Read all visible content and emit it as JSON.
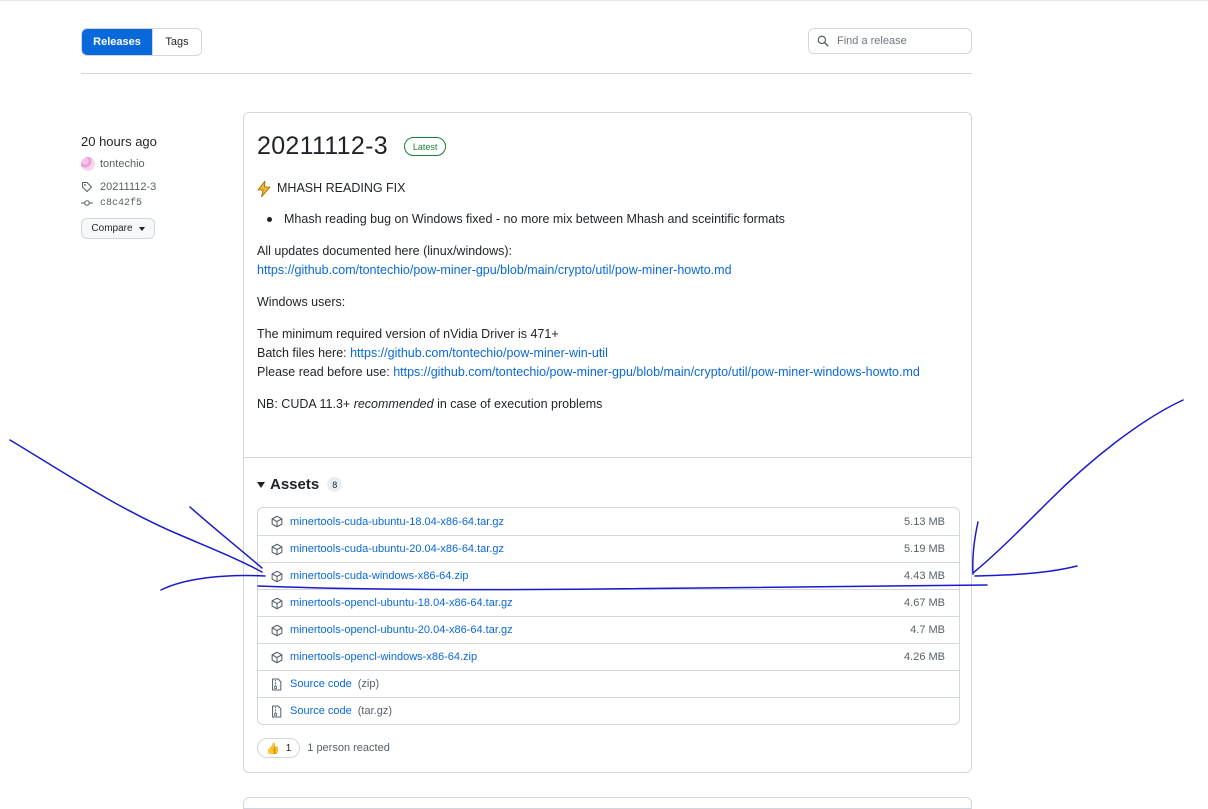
{
  "tabs": {
    "releases_label": "Releases",
    "tags_label": "Tags"
  },
  "search": {
    "placeholder": "Find a release"
  },
  "meta": {
    "time": "20 hours ago",
    "author": "tontechio",
    "tag": "20211112-3",
    "commit": "c8c42f5",
    "compare_label": "Compare"
  },
  "release": {
    "title": "20211112-3",
    "badge": "Latest",
    "fix_heading": "MHASH READING FIX",
    "bullet": "Mhash reading bug on Windows fixed - no more mix between Mhash and sceintific formats",
    "updates_text": "All updates documented here (linux/windows):",
    "updates_link": "https://github.com/tontechio/pow-miner-gpu/blob/main/crypto/util/pow-miner-howto.md",
    "windows_users": "Windows users:",
    "min_driver": "The minimum required version of nVidia Driver is 471+",
    "batch_prefix": "Batch files here: ",
    "batch_link": "https://github.com/tontechio/pow-miner-win-util",
    "read_prefix": "Please read before use: ",
    "read_link": "https://github.com/tontechio/pow-miner-gpu/blob/main/crypto/util/pow-miner-windows-howto.md",
    "nb_prefix": "NB: CUDA 11.3+ ",
    "nb_em": "recommended",
    "nb_suffix": " in case of execution problems"
  },
  "assets": {
    "title": "Assets",
    "count": "8",
    "files": [
      {
        "name": "minertools-cuda-ubuntu-18.04-x86-64.tar.gz",
        "size": "5.13 MB"
      },
      {
        "name": "minertools-cuda-ubuntu-20.04-x86-64.tar.gz",
        "size": "5.19 MB"
      },
      {
        "name": "minertools-cuda-windows-x86-64.zip",
        "size": "4.43 MB"
      },
      {
        "name": "minertools-opencl-ubuntu-18.04-x86-64.tar.gz",
        "size": "4.67 MB"
      },
      {
        "name": "minertools-opencl-ubuntu-20.04-x86-64.tar.gz",
        "size": "4.7 MB"
      },
      {
        "name": "minertools-opencl-windows-x86-64.zip",
        "size": "4.26 MB"
      }
    ],
    "sources": [
      {
        "name": "Source code",
        "type": "(zip)"
      },
      {
        "name": "Source code",
        "type": "(tar.gz)"
      }
    ]
  },
  "reactions": {
    "emoji": "👍",
    "count": "1",
    "text": "1 person reacted"
  },
  "colors": {
    "accent": "#0969da",
    "latest": "#1a7f37",
    "annotation": "#1a1acc"
  },
  "icons": [
    "search-icon",
    "person-avatar",
    "tag-icon",
    "commit-icon",
    "zap-icon",
    "package-icon",
    "file-zip-icon",
    "thumbs-up-icon"
  ]
}
